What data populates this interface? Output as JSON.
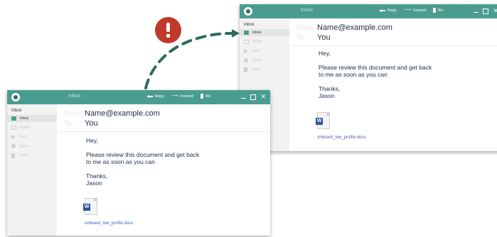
{
  "windows": [
    {
      "title": "Inbox",
      "toolbar": {
        "reply": "Reply",
        "forward": "Forward",
        "bin": "Bin"
      },
      "sidebar": {
        "header": "Inbox",
        "items": [
          {
            "label": "Inbox",
            "icon": "inbox-icon"
          },
          {
            "label": "Drafts",
            "icon": "drafts-icon"
          },
          {
            "label": "Sent",
            "icon": "sent-icon"
          },
          {
            "label": "Spam",
            "icon": "spam-icon"
          },
          {
            "label": "Trash",
            "icon": "trash-icon"
          }
        ]
      },
      "email": {
        "from_label": "From:",
        "from": "Name@example.com",
        "to_label": "To:",
        "to": "You",
        "greeting": "Hey,",
        "body_line1": "Please review this document and get back",
        "body_line2": "to me as soon as you can",
        "signoff": "Thanks,",
        "signature": "Jason",
        "attachment": "onboard_low_profile.docx",
        "attachment_badge": "W"
      }
    },
    {
      "title": "Inbox",
      "toolbar": {
        "reply": "Reply",
        "forward": "Forward",
        "bin": "Bin"
      },
      "sidebar": {
        "header": "Inbox",
        "items": [
          {
            "label": "Inbox",
            "icon": "inbox-icon"
          },
          {
            "label": "Drafts",
            "icon": "drafts-icon"
          },
          {
            "label": "Sent",
            "icon": "sent-icon"
          },
          {
            "label": "Spam",
            "icon": "spam-icon"
          },
          {
            "label": "Trash",
            "icon": "trash-icon"
          }
        ]
      },
      "email": {
        "from_label": "From:",
        "from": "Name@example.com",
        "to_label": "To:",
        "to": "You",
        "greeting": "Hey,",
        "body_line1": "Please review this document and get back",
        "body_line2": "to me as soon as you can",
        "signoff": "Thanks,",
        "signature": "Jason",
        "attachment": "onboard_low_profile.docx",
        "attachment_badge": "W"
      }
    }
  ],
  "alert": {
    "icon": "exclamation-icon",
    "color": "#c0392b"
  },
  "colors": {
    "titlebar": "#4a9d8e",
    "arrow": "#2e6b5e",
    "link": "#3a5fb4"
  }
}
